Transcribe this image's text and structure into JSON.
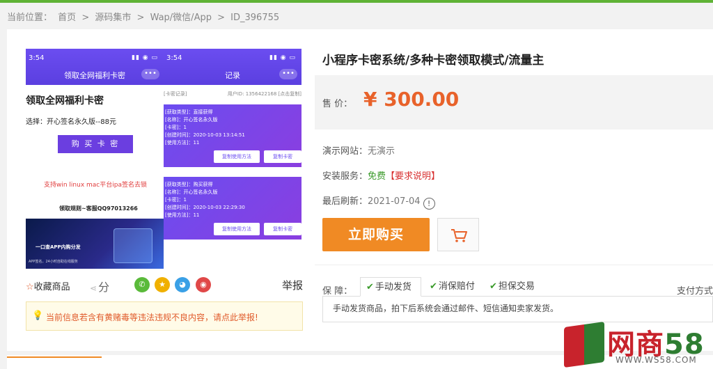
{
  "breadcrumb": {
    "prefix": "当前位置：",
    "items": [
      "首页",
      "源码集市",
      "Wap/微信/App",
      "ID_396755"
    ],
    "sep": ">"
  },
  "product_image": {
    "left_phone": {
      "time": "3:54",
      "title": "领取全网福利卡密",
      "heading": "领取全网福利卡密",
      "selection": "选择：开心签名永久版--88元",
      "buy_btn": "购 买 卡 密",
      "support": "支持win linux mac平台ipa签名去锁",
      "rules": "领取规则~客服QQ97013266",
      "banner_title": "一口查APP内购分发",
      "banner_sub": "APP签名，24小时自助在线服务"
    },
    "right_phone": {
      "time": "3:54",
      "title": "记录",
      "head_left": "[卡密记录]",
      "head_right": "用户ID: 1356422168 [点击复制]",
      "records": [
        {
          "lines": [
            "[获取类型]：直接获得",
            "[名称]：开心签名永久版",
            "[卡密]：1",
            "[创建时间]：2020-10-03 13:14:51",
            "[使用方法]：11"
          ],
          "btn1": "复制使用方法",
          "btn2": "复制卡密"
        },
        {
          "lines": [
            "[获取类型]：购买获得",
            "[名称]：开心签名永久版",
            "[卡密]：1",
            "[创建时间]：2020-10-03 22:29:30",
            "[使用方法]：11"
          ],
          "btn1": "复制使用方法",
          "btn2": "复制卡密"
        }
      ]
    }
  },
  "actions": {
    "favorite": "收藏商品",
    "share": "分",
    "report": "举报"
  },
  "notice": "当前信息若含有黄赌毒等违法违规不良内容，请点此举报!",
  "product": {
    "title": "小程序卡密系统/多种卡密领取模式/流量主",
    "price_label": "售  价：",
    "price": "¥ 300.00",
    "demo_label": "演示网站：",
    "demo_value": "无演示",
    "install_label": "安装服务：",
    "install_value": "免费",
    "install_link": "【要求说明】",
    "refresh_label": "最后刷新：",
    "refresh_value": "2021-07-04",
    "buy_button": "立即购买"
  },
  "guarantee": {
    "label": "保  障：",
    "tabs": [
      "手动发货",
      "消保赔付",
      "担保交易"
    ],
    "payment": "支付方式",
    "description": "手动发货商品，拍下后系统会通过邮件、短信通知卖家发货。"
  },
  "watermark": {
    "brand_a": "网商",
    "brand_b": "58",
    "site": "WWW.WS58.COM"
  },
  "colors": {
    "accent": "#f08a24",
    "price": "#e8622a",
    "top_bar": "#5fb336"
  }
}
